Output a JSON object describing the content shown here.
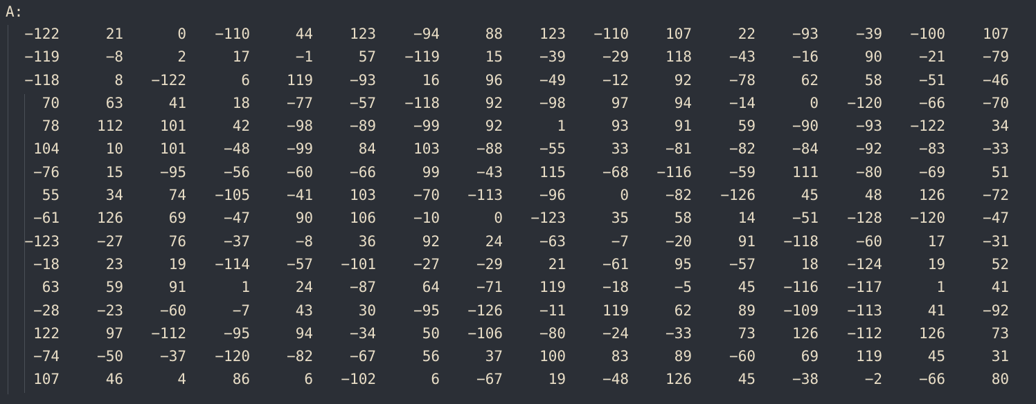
{
  "variable_label": "A:",
  "matrix": [
    [
      -122,
      21,
      0,
      -110,
      44,
      123,
      -94,
      88,
      123,
      -110,
      107,
      22,
      -93,
      -39,
      -100,
      107
    ],
    [
      -119,
      -8,
      2,
      17,
      -1,
      57,
      -119,
      15,
      -39,
      -29,
      118,
      -43,
      -16,
      90,
      -21,
      -79
    ],
    [
      -118,
      8,
      -122,
      6,
      119,
      -93,
      16,
      96,
      -49,
      -12,
      92,
      -78,
      62,
      58,
      -51,
      -46
    ],
    [
      70,
      63,
      41,
      18,
      -77,
      -57,
      -118,
      92,
      -98,
      97,
      94,
      -14,
      0,
      -120,
      -66,
      -70
    ],
    [
      78,
      112,
      101,
      42,
      -98,
      -89,
      -99,
      92,
      1,
      93,
      91,
      59,
      -90,
      -93,
      -122,
      34
    ],
    [
      104,
      10,
      101,
      -48,
      -99,
      84,
      103,
      -88,
      -55,
      33,
      -81,
      -82,
      -84,
      -92,
      -83,
      -33
    ],
    [
      -76,
      15,
      -95,
      -56,
      -60,
      -66,
      99,
      -43,
      115,
      -68,
      -116,
      -59,
      111,
      -80,
      -69,
      51
    ],
    [
      55,
      34,
      74,
      -105,
      -41,
      103,
      -70,
      -113,
      -96,
      0,
      -82,
      -126,
      45,
      48,
      126,
      -72
    ],
    [
      -61,
      126,
      69,
      -47,
      90,
      106,
      -10,
      0,
      -123,
      35,
      58,
      14,
      -51,
      -128,
      -120,
      -47
    ],
    [
      -123,
      -27,
      76,
      -37,
      -8,
      36,
      92,
      24,
      -63,
      -7,
      -20,
      91,
      -118,
      -60,
      17,
      -31
    ],
    [
      -18,
      23,
      19,
      -114,
      -57,
      -101,
      -27,
      -29,
      21,
      -61,
      95,
      -57,
      18,
      -124,
      19,
      52
    ],
    [
      63,
      59,
      91,
      1,
      24,
      -87,
      64,
      -71,
      119,
      -18,
      -5,
      45,
      -116,
      -117,
      1,
      41
    ],
    [
      -28,
      -23,
      -60,
      -7,
      43,
      30,
      -95,
      -126,
      -11,
      119,
      62,
      89,
      -109,
      -113,
      41,
      -92
    ],
    [
      122,
      97,
      -112,
      -95,
      94,
      -34,
      50,
      -106,
      -80,
      -24,
      -33,
      73,
      126,
      -112,
      126,
      73
    ],
    [
      -74,
      -50,
      -37,
      -120,
      -82,
      -67,
      56,
      37,
      100,
      83,
      89,
      -60,
      69,
      119,
      45,
      31
    ],
    [
      107,
      46,
      4,
      86,
      6,
      -102,
      6,
      -67,
      19,
      -48,
      126,
      45,
      -38,
      -2,
      -66,
      80
    ]
  ],
  "colors": {
    "background": "#2b2f36",
    "text": "#e8ddc6",
    "guide": "#4a4f57"
  }
}
